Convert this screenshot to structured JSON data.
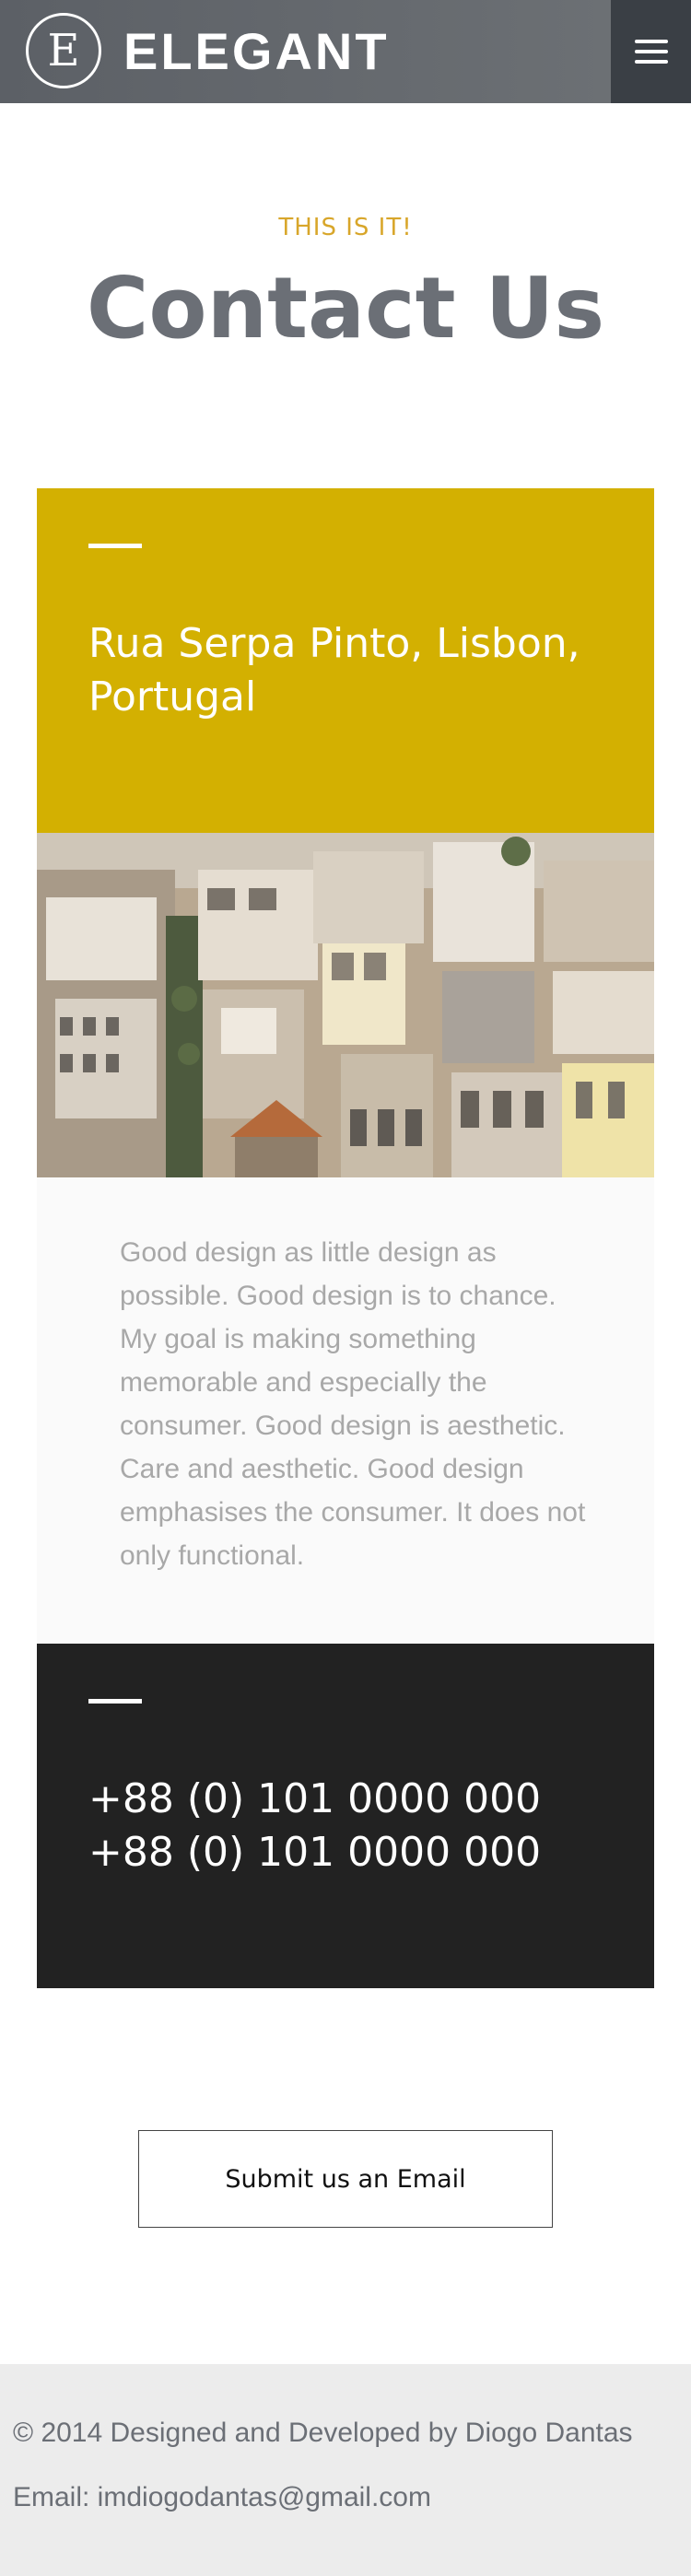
{
  "header": {
    "logo_letter": "E",
    "brand": "ELEGANT",
    "menu_icon": "hamburger-menu-icon"
  },
  "hero": {
    "eyebrow": "THIS IS IT!",
    "title": "Contact Us"
  },
  "address_card": {
    "address": "Rua Serpa Pinto, Lisbon, Portugal",
    "color": "#d3b001"
  },
  "description": "Good design as little design as possible. Good design is to chance. My goal is making something memorable and especially the consumer. Good design is aesthetic. Care and aesthetic. Good design emphasises the consumer. It does not only functional.",
  "phone_card": {
    "phones": [
      "+88 (0) 101 0000 000",
      "+88 (0) 101 0000 000"
    ],
    "color": "#222222"
  },
  "cta": {
    "label": "Submit us an Email"
  },
  "footer": {
    "copyright": "© 2014 Designed and Developed by Diogo Dantas",
    "email": "Email: imdiogodantas@gmail.com"
  },
  "colors": {
    "accent": "#d8a62a",
    "header": "#5c6066"
  }
}
